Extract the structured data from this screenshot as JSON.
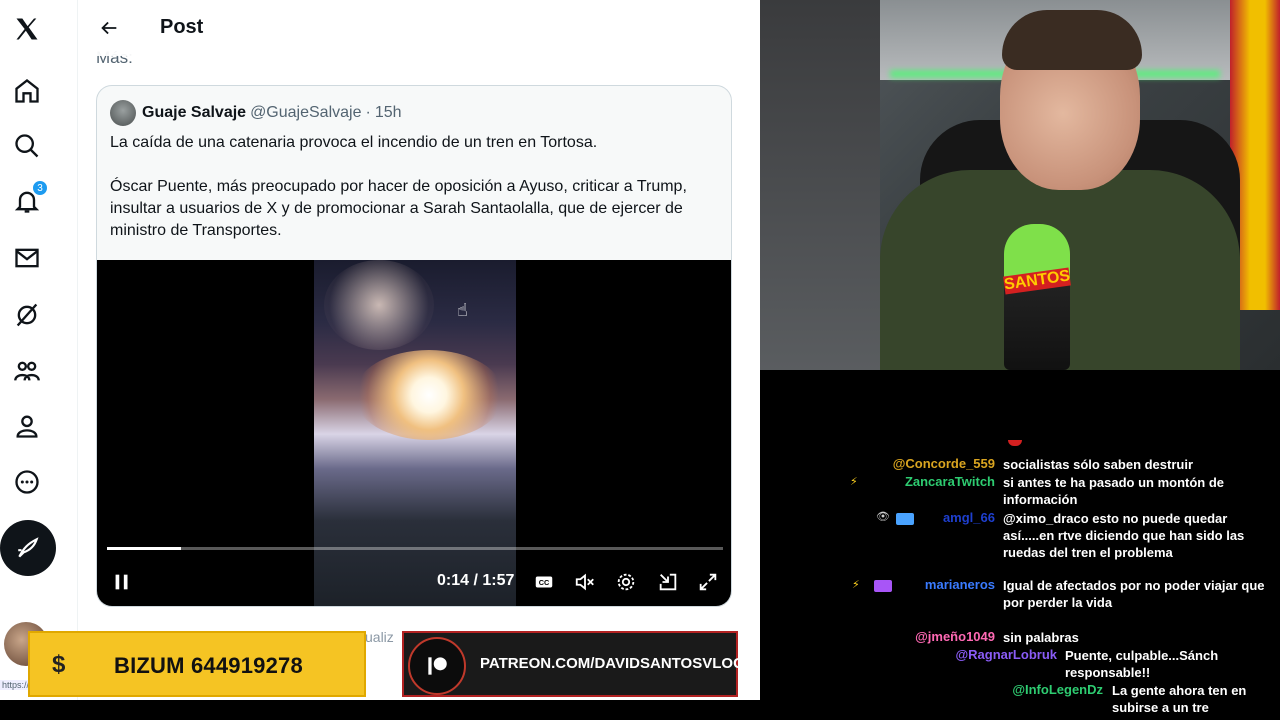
{
  "x_app": {
    "header_title": "Post",
    "mas_text": "Más:",
    "notification_count": "3",
    "below_video_text": "ualiz",
    "url_fragment": "https://x.co"
  },
  "quote": {
    "author_name": "Guaje Salvaje",
    "author_handle": "@GuajeSalvaje",
    "dot": "·",
    "time": "15h",
    "paragraph1": "La caída de una catenaria provoca el incendio de un tren en Tortosa.",
    "paragraph2": "Óscar Puente, más preocupado por hacer de oposición a Ayuso, criticar a Trump, insultar a usuarios de X y de promocionar a Sarah Santaolalla, que de ejercer de ministro de Transportes."
  },
  "video": {
    "time_display": "0:14 / 1:57",
    "progress": 0.12
  },
  "banners": {
    "bizum_symbol": "$",
    "bizum_text": "BIZUM 644919278",
    "patreon_text": "PATREON.COM/DAVIDSANTOSVLOG"
  },
  "cam": {
    "mic_label": "SANTOS"
  },
  "chat": {
    "messages": [
      {
        "user": "@Concorde_559",
        "color": "#daa520",
        "text": "socialistas sólo saben destruir"
      },
      {
        "user": "ZancaraTwitch",
        "color": "#2ecc71",
        "text": "si antes te ha pasado un montón de información"
      },
      {
        "user": "amgl_66",
        "color": "#1e3fcf",
        "text": "@ximo_draco esto no puede quedar así.....en rtve diciendo que han sido las ruedas del tren el problema"
      },
      {
        "user": "marianeros",
        "color": "#3a7bff",
        "text": "Igual de afectados por no poder viajar que por perder la vida"
      },
      {
        "user": "@jmeño1049",
        "color": "#ff69b4",
        "text": "sin palabras"
      },
      {
        "user": "@RagnarLobruk",
        "color": "#8a5cf6",
        "text": "Puente, culpable...Sánch responsable!!"
      },
      {
        "user": "@InfoLegenDz",
        "color": "#2ecc71",
        "text": "La gente ahora ten en subirse a un tre"
      }
    ]
  }
}
